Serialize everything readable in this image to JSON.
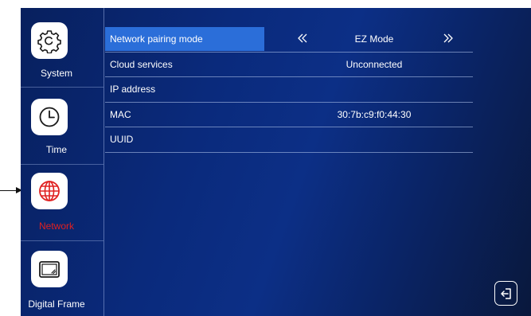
{
  "sidebar": {
    "items": [
      {
        "label": "System",
        "icon": "gear-icon"
      },
      {
        "label": "Time",
        "icon": "clock-icon"
      },
      {
        "label": "Network",
        "icon": "globe-icon",
        "active": true
      },
      {
        "label": "Digital Frame",
        "icon": "picture-frame-icon"
      }
    ]
  },
  "settings": {
    "rows": [
      {
        "label": "Network pairing mode",
        "value": "EZ Mode",
        "selected": true
      },
      {
        "label": "Cloud services",
        "value": "Unconnected"
      },
      {
        "label": "IP address",
        "value": ""
      },
      {
        "label": "MAC",
        "value": "30:7b:c9:f0:44:30"
      },
      {
        "label": "UUID",
        "value": ""
      }
    ]
  },
  "icons": {
    "prev": "double-left-arrow-icon",
    "next": "double-right-arrow-icon",
    "exit": "exit-icon"
  },
  "colors": {
    "accent": "#2b6ed9",
    "active_label": "#e02020",
    "background_start": "#08205e",
    "background_end": "#09183c"
  }
}
